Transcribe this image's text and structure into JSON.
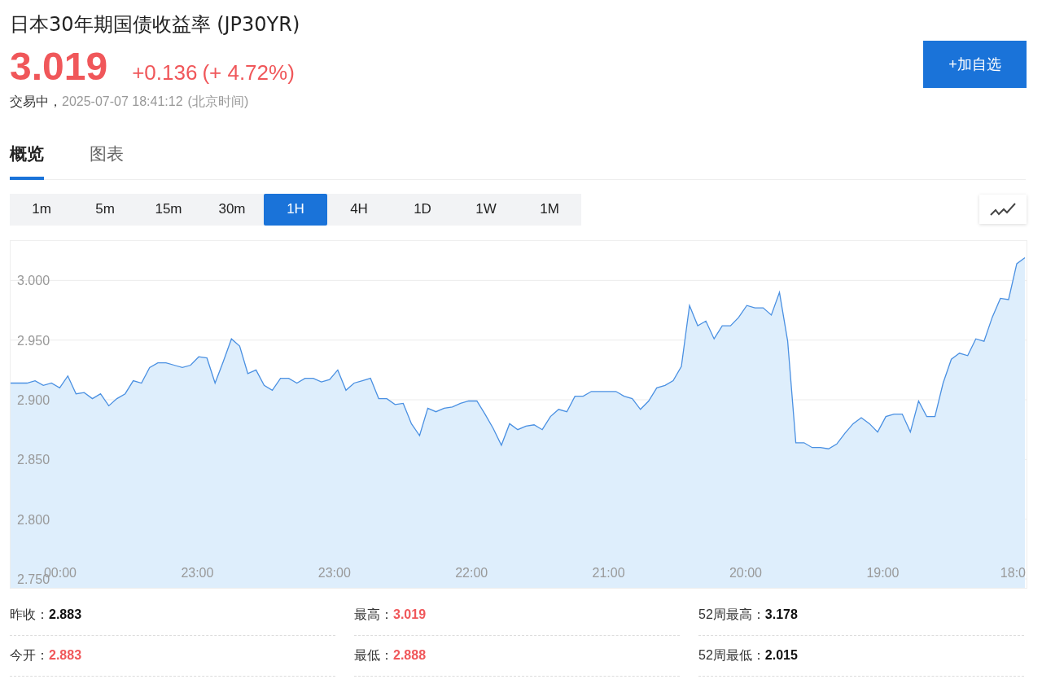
{
  "header": {
    "title": "日本30年期国债收益率 (JP30YR)",
    "price": "3.019",
    "change": "+0.136",
    "change_percent": "(+ 4.72%)",
    "status": "交易中，",
    "timestamp": "2025-07-07 18:41:12",
    "timezone": "(北京时间)",
    "watchlist_button": "+加自选"
  },
  "tabs": [
    {
      "label": "概览",
      "selected": true
    },
    {
      "label": "图表",
      "selected": false
    }
  ],
  "intervals": [
    {
      "label": "1m",
      "selected": false
    },
    {
      "label": "5m",
      "selected": false
    },
    {
      "label": "15m",
      "selected": false
    },
    {
      "label": "30m",
      "selected": false
    },
    {
      "label": "1H",
      "selected": true
    },
    {
      "label": "4H",
      "selected": false
    },
    {
      "label": "1D",
      "selected": false
    },
    {
      "label": "1W",
      "selected": false
    },
    {
      "label": "1M",
      "selected": false
    }
  ],
  "chart": {
    "x_axis_labels": [
      "00:00",
      "23:00",
      "23:00",
      "22:00",
      "21:00",
      "20:00",
      "19:00",
      "18:0"
    ],
    "chart_data": {
      "type": "area",
      "grid": true,
      "ylim": [
        2.75,
        3.033
      ],
      "yticks": [
        {
          "value": 2.75,
          "label": "2.750"
        },
        {
          "value": 2.8,
          "label": "2.800"
        },
        {
          "value": 2.85,
          "label": "2.850"
        },
        {
          "value": 2.9,
          "label": "2.900"
        },
        {
          "value": 2.95,
          "label": "2.950"
        },
        {
          "value": 3.0,
          "label": "3.000"
        }
      ],
      "series": [
        {
          "color": "#4a90e2",
          "values": [
            2.914,
            2.914,
            2.914,
            2.916,
            2.912,
            2.914,
            2.91,
            2.92,
            2.905,
            2.906,
            2.901,
            2.905,
            2.895,
            2.901,
            2.905,
            2.916,
            2.914,
            2.927,
            2.931,
            2.931,
            2.929,
            2.927,
            2.929,
            2.936,
            2.935,
            2.914,
            2.932,
            2.951,
            2.945,
            2.922,
            2.925,
            2.912,
            2.908,
            2.918,
            2.918,
            2.914,
            2.918,
            2.918,
            2.915,
            2.917,
            2.925,
            2.908,
            2.914,
            2.916,
            2.918,
            2.901,
            2.901,
            2.896,
            2.897,
            2.88,
            2.87,
            2.893,
            2.89,
            2.893,
            2.894,
            2.897,
            2.899,
            2.899,
            2.888,
            2.876,
            2.862,
            2.88,
            2.875,
            2.878,
            2.879,
            2.875,
            2.886,
            2.892,
            2.89,
            2.903,
            2.903,
            2.907,
            2.907,
            2.907,
            2.907,
            2.903,
            2.901,
            2.892,
            2.899,
            2.91,
            2.912,
            2.916,
            2.928,
            2.979,
            2.962,
            2.966,
            2.951,
            2.962,
            2.962,
            2.969,
            2.979,
            2.977,
            2.977,
            2.971,
            2.99,
            2.949,
            2.864,
            2.864,
            2.86,
            2.86,
            2.859,
            2.863,
            2.872,
            2.88,
            2.885,
            2.88,
            2.873,
            2.886,
            2.888,
            2.888,
            2.873,
            2.899,
            2.886,
            2.886,
            2.914,
            2.934,
            2.939,
            2.937,
            2.951,
            2.949,
            2.969,
            2.985,
            2.984,
            3.014,
            3.019
          ]
        }
      ]
    }
  },
  "stats": [
    {
      "label": "昨收：",
      "value": "2.883",
      "color": "#111111"
    },
    {
      "label": "最高：",
      "value": "3.019",
      "color": "#f0575a"
    },
    {
      "label": "52周最高：",
      "value": "3.178",
      "color": "#111111"
    },
    {
      "label": "今开：",
      "value": "2.883",
      "color": "#f0575a"
    },
    {
      "label": "最低：",
      "value": "2.888",
      "color": "#f0575a"
    },
    {
      "label": "52周最低：",
      "value": "2.015",
      "color": "#111111"
    }
  ]
}
